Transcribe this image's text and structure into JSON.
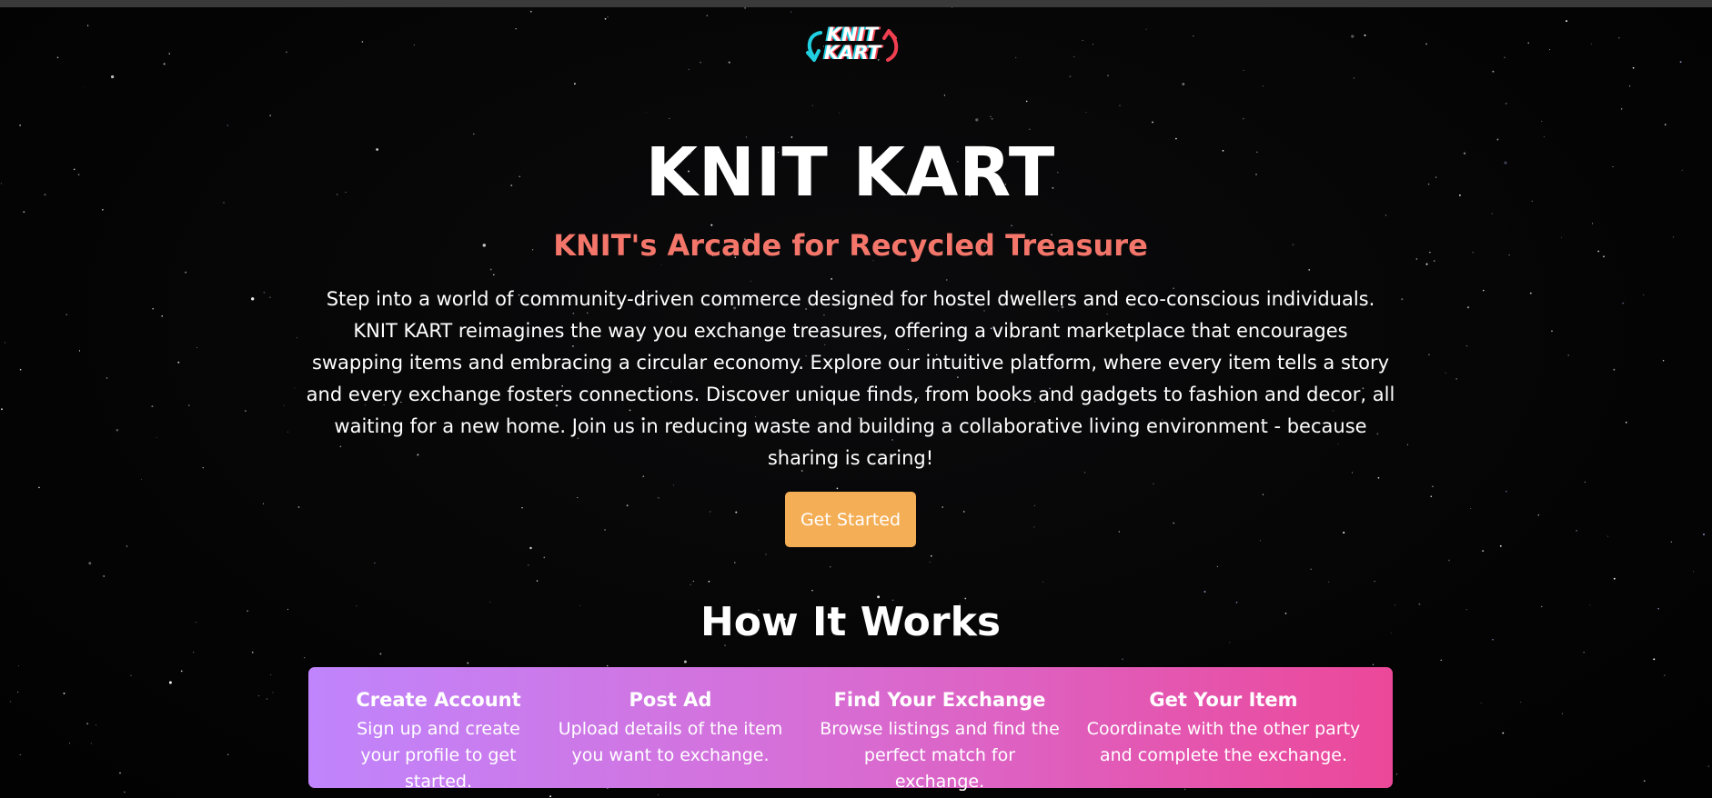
{
  "logo": {
    "line1": "KNIT",
    "line2": "KART",
    "colors": {
      "left_arrow": "#21d0e0",
      "right_arrow": "#ef3f50"
    }
  },
  "hero": {
    "title": "KNIT KART",
    "subtitle": "KNIT's Arcade for Recycled Treasure",
    "description": "Step into a world of community-driven commerce designed for hostel dwellers and eco-conscious individuals. KNIT KART reimagines the way you exchange treasures, offering a vibrant marketplace that encourages swapping items and embracing a circular economy. Explore our intuitive platform, where every item tells a story and every exchange fosters connections. Discover unique finds, from books and gadgets to fashion and decor, all waiting for a new home. Join us in reducing waste and building a collaborative living environment - because sharing is caring!",
    "cta_label": "Get Started"
  },
  "how_it_works": {
    "title": "How It Works",
    "steps": [
      {
        "title": "Create Account",
        "description": "Sign up and create your profile to get started."
      },
      {
        "title": "Post Ad",
        "description": "Upload details of the item you want to exchange."
      },
      {
        "title": "Find Your Exchange",
        "description": "Browse listings and find the perfect match for exchange."
      },
      {
        "title": "Get Your Item",
        "description": "Coordinate with the other party and complete the exchange."
      }
    ]
  },
  "colors": {
    "background": "#050505",
    "subtitle": "#f4766a",
    "cta": "#f4ae55",
    "gradient_start": "#c084fc",
    "gradient_end": "#ec4899"
  }
}
